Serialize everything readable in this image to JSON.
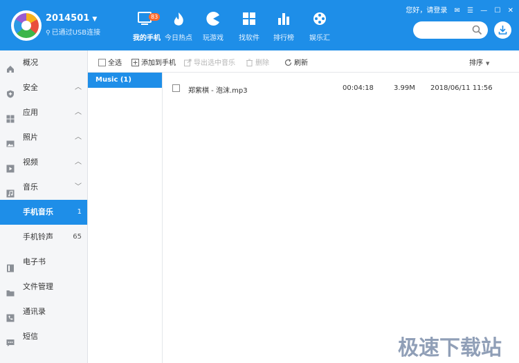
{
  "header": {
    "device_name": "2014501",
    "device_status": "已通过USB连接",
    "nav": [
      {
        "label": "我的手机",
        "badge": "83",
        "icon": "phone-icon",
        "active": true
      },
      {
        "label": "今日热点",
        "icon": "flame-icon",
        "active": false
      },
      {
        "label": "玩游戏",
        "icon": "pacman-icon",
        "active": false
      },
      {
        "label": "找软件",
        "icon": "apps-grid-icon",
        "active": false
      },
      {
        "label": "排行榜",
        "icon": "bar-chart-icon",
        "active": false
      },
      {
        "label": "娱乐汇",
        "icon": "film-reel-icon",
        "active": false
      }
    ],
    "greeting": "您好，请登录",
    "search": {
      "placeholder": "",
      "value": ""
    }
  },
  "sidebar": {
    "items": [
      {
        "label": "概况",
        "icon": "home-icon"
      },
      {
        "label": "安全",
        "icon": "shield-icon",
        "chevron": "^"
      },
      {
        "label": "应用",
        "icon": "apps-icon",
        "chevron": "^"
      },
      {
        "label": "照片",
        "icon": "photo-icon",
        "chevron": "^"
      },
      {
        "label": "视频",
        "icon": "video-icon",
        "chevron": "^"
      },
      {
        "label": "音乐",
        "icon": "music-icon",
        "chevron": "v"
      },
      {
        "label": "手机音乐",
        "count": "1",
        "sub": true,
        "active": true
      },
      {
        "label": "手机铃声",
        "count": "65",
        "sub": true
      },
      {
        "label": "电子书",
        "icon": "book-icon"
      },
      {
        "label": "文件管理",
        "icon": "folder-icon"
      },
      {
        "label": "通讯录",
        "icon": "contacts-icon"
      },
      {
        "label": "短信",
        "icon": "message-icon"
      }
    ]
  },
  "toolbar": {
    "select_all": "全选",
    "add_to_phone": "添加到手机",
    "export_selected": "导出选中音乐",
    "delete": "删除",
    "refresh": "刷新",
    "sort": "排序"
  },
  "folders": [
    {
      "label": "Music (1)"
    }
  ],
  "files": [
    {
      "name": "郑紫棋 - 泡沫.mp3",
      "duration": "00:04:18",
      "size": "3.99M",
      "date": "2018/06/11 11:56"
    }
  ],
  "watermark": "极速下载站",
  "colors": {
    "accent": "#1e8ee8",
    "badge": "#ff6a2b"
  }
}
